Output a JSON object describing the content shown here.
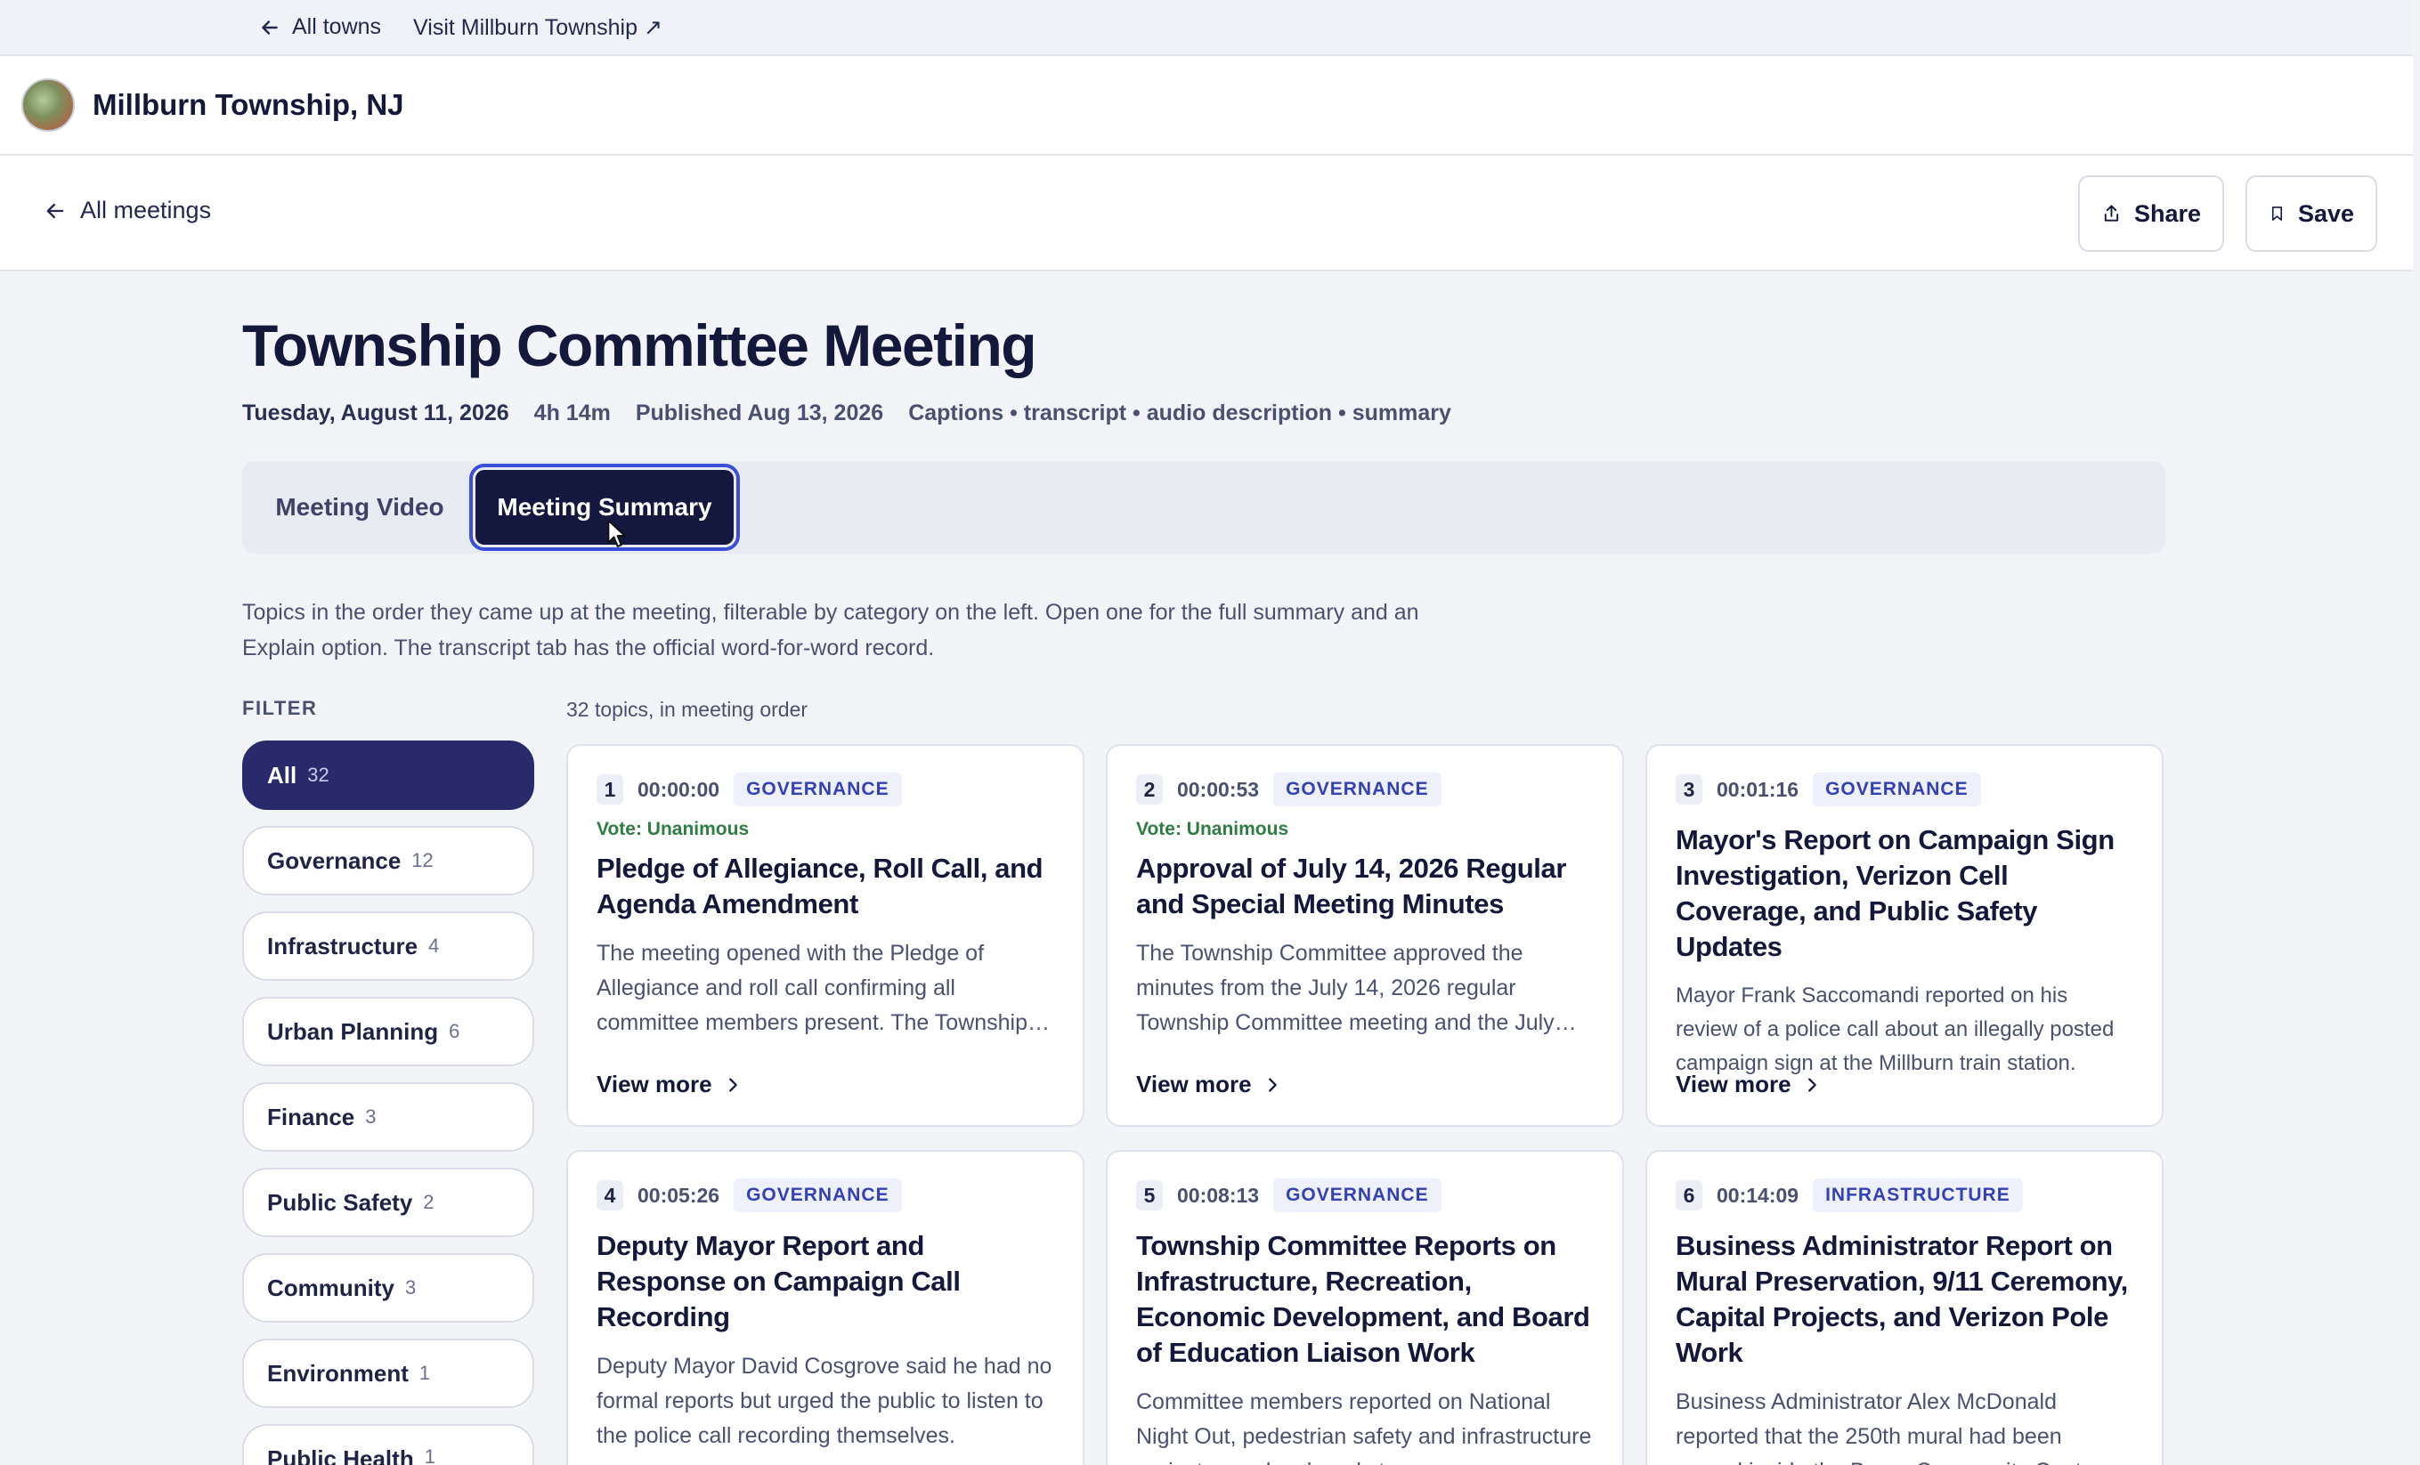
{
  "topbar": {
    "all_towns": "All towns",
    "visit": "Visit Millburn Township ↗"
  },
  "header": {
    "town": "Millburn Township, NJ"
  },
  "subheader": {
    "back": "All meetings",
    "share": "Share",
    "save": "Save"
  },
  "meeting": {
    "title": "Township Committee Meeting",
    "date": "Tuesday, August 11, 2026",
    "duration": "4h 14m",
    "published": "Published Aug 13, 2026",
    "assets": "Captions • transcript • audio description • summary"
  },
  "tabs": {
    "video": "Meeting Video",
    "summary": "Meeting Summary"
  },
  "intro": "Topics in the order they came up at the meeting, filterable by category on the left. Open one for the full summary and an Explain option. The transcript tab has the official word-for-word record.",
  "filter_label": "FILTER",
  "count_label": "32 topics, in meeting order",
  "filters": [
    {
      "label": "All",
      "count": "32"
    },
    {
      "label": "Governance",
      "count": "12"
    },
    {
      "label": "Infrastructure",
      "count": "4"
    },
    {
      "label": "Urban Planning",
      "count": "6"
    },
    {
      "label": "Finance",
      "count": "3"
    },
    {
      "label": "Public Safety",
      "count": "2"
    },
    {
      "label": "Community",
      "count": "3"
    },
    {
      "label": "Environment",
      "count": "1"
    },
    {
      "label": "Public Health",
      "count": "1"
    }
  ],
  "view_more": "View more",
  "cards": [
    {
      "num": "1",
      "time": "00:00:00",
      "category": "GOVERNANCE",
      "vote": "Vote: Unanimous",
      "title": "Pledge of Allegiance, Roll Call, and Agenda Amendment",
      "desc": "The meeting opened with the Pledge of Allegiance and roll call confirming all committee members present. The Township Committee also amended the agenda."
    },
    {
      "num": "2",
      "time": "00:00:53",
      "category": "GOVERNANCE",
      "vote": "Vote: Unanimous",
      "title": "Approval of July 14, 2026 Regular and Special Meeting Minutes",
      "desc": "The Township Committee approved the minutes from the July 14, 2026 regular Township Committee meeting and the July special meeting."
    },
    {
      "num": "3",
      "time": "00:01:16",
      "category": "GOVERNANCE",
      "vote": "",
      "title": "Mayor's Report on Campaign Sign Investigation, Verizon Cell Coverage, and Public Safety Updates",
      "desc": "Mayor Frank Saccomandi reported on his review of a police call about an illegally posted campaign sign at the Millburn train station."
    },
    {
      "num": "4",
      "time": "00:05:26",
      "category": "GOVERNANCE",
      "vote": "",
      "title": "Deputy Mayor Report and Response on Campaign Call Recording",
      "desc": "Deputy Mayor David Cosgrove said he had no formal reports but urged the public to listen to the police call recording themselves."
    },
    {
      "num": "5",
      "time": "00:08:13",
      "category": "GOVERNANCE",
      "vote": "",
      "title": "Township Committee Reports on Infrastructure, Recreation, Economic Development, and Board of Education Liaison Work",
      "desc": "Committee members reported on National Night Out, pedestrian safety and infrastructure projects, roadwork and storm"
    },
    {
      "num": "6",
      "time": "00:14:09",
      "category": "INFRASTRUCTURE",
      "vote": "",
      "title": "Business Administrator Report on Mural Preservation, 9/11 Ceremony, Capital Projects, and Verizon Pole Work",
      "desc": "Business Administrator Alex McDonald reported that the 250th mural had been moved inside the Bauer Community Center"
    }
  ]
}
